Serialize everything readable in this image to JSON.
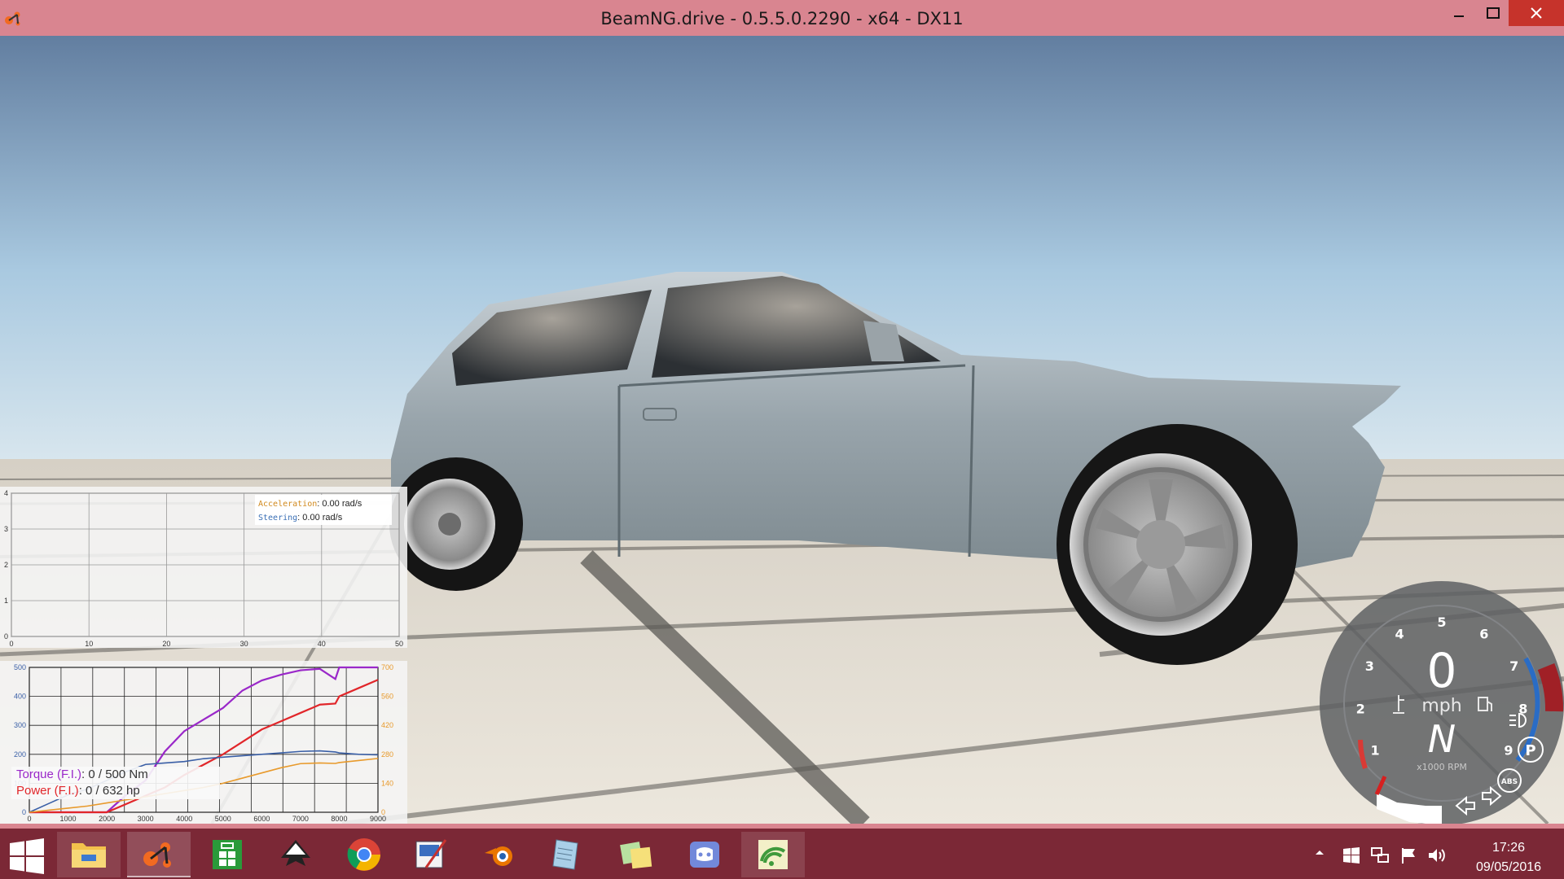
{
  "window": {
    "title": "BeamNG.drive - 0.5.5.0.2290 - x64 - DX11",
    "icons": [
      "beamng-logo-icon",
      "minimize-icon",
      "maximize-icon",
      "close-icon"
    ]
  },
  "accel_graph": {
    "legend": {
      "acceleration_key": "Acceleration",
      "acceleration_value": ": 0.00 rad/s",
      "steering_key": "Steering",
      "steering_value": ": 0.00 rad/s"
    },
    "y_ticks": [
      "0",
      "1",
      "2",
      "3",
      "4"
    ],
    "x_ticks": [
      "0",
      "10",
      "20",
      "30",
      "40",
      "50"
    ]
  },
  "torque_graph": {
    "legend": {
      "torque_key": "Torque (F.I.)",
      "torque_value": ": 0 / 500 Nm",
      "power_key": "Power (F.I.)",
      "power_value": ": 0 / 632 hp"
    },
    "left_ticks": [
      "0",
      "100",
      "200",
      "300",
      "400",
      "500"
    ],
    "right_ticks": [
      "0",
      "140",
      "280",
      "420",
      "560",
      "700"
    ],
    "x_ticks": [
      "0",
      "1000",
      "2000",
      "3000",
      "4000",
      "5000",
      "6000",
      "7000",
      "8000",
      "9000"
    ],
    "colors": {
      "torque": "#9a28c9",
      "power": "#e1262a",
      "torque_base": "#3a5fa6",
      "power_base": "#e89a2c"
    }
  },
  "chart_data": [
    {
      "type": "line",
      "title": "",
      "xlabel": "",
      "ylabel": "",
      "xlim": [
        0,
        50
      ],
      "ylim": [
        0,
        4
      ],
      "x_ticks": [
        0,
        10,
        20,
        30,
        40,
        50
      ],
      "y_ticks": [
        0,
        1,
        2,
        3,
        4
      ],
      "grid": true,
      "legend": "top-right",
      "series": [
        {
          "name": "Acceleration",
          "values": []
        },
        {
          "name": "Steering",
          "values": []
        }
      ]
    },
    {
      "type": "line",
      "title": "",
      "xlabel": "",
      "ylabel": "",
      "xlim": [
        0,
        9000
      ],
      "ylim_left": [
        0,
        500
      ],
      "ylim_right": [
        0,
        700
      ],
      "grid": true,
      "legend": "bottom-left",
      "x": [
        0,
        500,
        1000,
        1500,
        2000,
        2500,
        3000,
        3500,
        4000,
        4500,
        5000,
        5500,
        6000,
        6500,
        7000,
        7500,
        7900,
        8000,
        8500,
        9000
      ],
      "series": [
        {
          "name": "Torque (F.I.)",
          "axis": "left",
          "values": [
            0,
            0,
            0,
            0,
            0,
            60,
            110,
            210,
            280,
            320,
            360,
            420,
            455,
            475,
            490,
            495,
            460,
            500,
            500,
            500
          ]
        },
        {
          "name": "Power (F.I.)",
          "axis": "right",
          "values": [
            0,
            0,
            0,
            0,
            0,
            40,
            80,
            120,
            180,
            230,
            280,
            340,
            400,
            440,
            480,
            520,
            525,
            560,
            600,
            640
          ]
        },
        {
          "values": [
            0,
            30,
            60,
            80,
            110,
            140,
            165,
            170,
            175,
            185,
            190,
            195,
            200,
            205,
            210,
            212,
            208,
            205,
            200,
            198
          ]
        },
        {
          "values": [
            0,
            10,
            20,
            30,
            45,
            60,
            75,
            90,
            105,
            120,
            140,
            165,
            190,
            215,
            235,
            238,
            236,
            240,
            250,
            260
          ]
        }
      ]
    }
  ],
  "gauge": {
    "speed": "0",
    "unit": "mph",
    "gear": "N",
    "rpm_label": "x1000 RPM",
    "rpm_numbers": [
      "1",
      "2",
      "3",
      "4",
      "5",
      "6",
      "7",
      "8",
      "9"
    ],
    "abs_label": "ABS",
    "parking_label": "P",
    "icons": [
      "coolant-temp-icon",
      "fuel-icon",
      "headlight-icon",
      "parking-brake-icon",
      "abs-icon",
      "left-signal-icon",
      "right-signal-icon"
    ]
  },
  "taskbar": {
    "apps": [
      {
        "name": "file-explorer",
        "icon": "folder-icon"
      },
      {
        "name": "beamng",
        "icon": "beamng-logo-icon"
      },
      {
        "name": "store",
        "icon": "store-icon"
      },
      {
        "name": "inkscape",
        "icon": "inkscape-icon"
      },
      {
        "name": "chrome",
        "icon": "chrome-icon"
      },
      {
        "name": "paint",
        "icon": "paint-icon"
      },
      {
        "name": "blender",
        "icon": "blender-icon"
      },
      {
        "name": "notepad",
        "icon": "notepad-icon"
      },
      {
        "name": "sticky-notes",
        "icon": "sticky-notes-icon"
      },
      {
        "name": "discord",
        "icon": "discord-icon"
      },
      {
        "name": "wifi-app",
        "icon": "wifi-app-icon"
      }
    ],
    "tray_icons": [
      "chevron-up-icon",
      "windows-flag-icon",
      "network-icon",
      "action-center-flag-icon",
      "volume-icon"
    ],
    "clock_time": "17:26",
    "clock_date": "09/05/2016"
  }
}
